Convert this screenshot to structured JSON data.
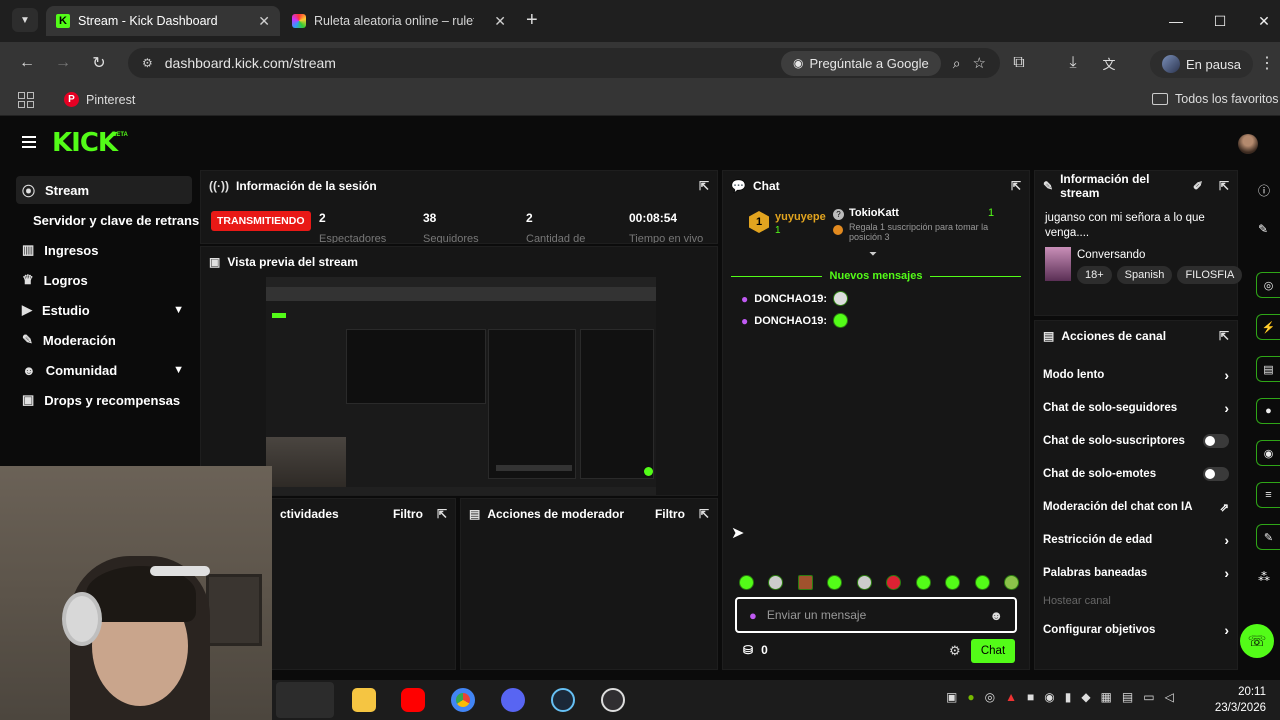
{
  "browser": {
    "tabs": [
      {
        "title": "Stream - Kick Dashboard",
        "active": true
      },
      {
        "title": "Ruleta aleatoria online – ruleta",
        "active": false
      }
    ],
    "url": "dashboard.kick.com/stream",
    "ask_google": "Pregúntale a Google",
    "profile_status": "En pausa",
    "bookmark": "Pinterest",
    "all_bookmarks": "Todos los favoritos"
  },
  "kick": {
    "logo": "KICK",
    "logo_badge": "BETA",
    "sidebar": [
      {
        "label": "Stream",
        "icon": "broadcast-icon",
        "selected": true
      },
      {
        "label": "Servidor y clave de retransm",
        "icon": "",
        "sub": true
      },
      {
        "label": "Ingresos",
        "icon": "chart-icon"
      },
      {
        "label": "Logros",
        "icon": "trophy-icon"
      },
      {
        "label": "Estudio",
        "icon": "video-icon",
        "expandable": true
      },
      {
        "label": "Moderación",
        "icon": "wrench-icon"
      },
      {
        "label": "Comunidad",
        "icon": "people-icon",
        "expandable": true
      },
      {
        "label": "Drops y recompensas",
        "icon": "gift-icon"
      }
    ],
    "session": {
      "title": "Información de la sesión",
      "status": "TRANSMITIENDO",
      "stats": [
        {
          "value": "2",
          "label": "Espectadores"
        },
        {
          "value": "38",
          "label": "Seguidores"
        },
        {
          "value": "2",
          "label": "Cantidad de"
        },
        {
          "value": "00:08:54",
          "label": "Tiempo en vivo"
        }
      ]
    },
    "preview": {
      "title": "Vista previa del stream"
    },
    "activity": {
      "title": "ctividades",
      "filter": "Filtro"
    },
    "mod_actions": {
      "title": "Acciones de moderador",
      "filter": "Filtro"
    },
    "chat": {
      "title": "Chat",
      "pinned_user": "yuyuyepe",
      "pinned_rank": "1",
      "pinned_count": "1",
      "gifter": "TokioKatt",
      "gifter_count": "1",
      "gift_text": "Regala 1 suscripción para tomar la posición 3",
      "new_messages": "Nuevos mensajes",
      "messages": [
        {
          "user": "DONCHAO19:"
        },
        {
          "user": "DONCHAO19:"
        }
      ],
      "placeholder": "Enviar un mensaje",
      "points": "0",
      "send": "Chat"
    },
    "stream_info": {
      "title": "Información del stream",
      "stream_title": "juganso con mi señora a lo que venga....",
      "category": "Conversando",
      "tags": [
        "18+",
        "Spanish",
        "FILOSFIA"
      ]
    },
    "channel_actions": {
      "title": "Acciones de canal",
      "items": [
        {
          "label": "Modo lento",
          "control": "arrow"
        },
        {
          "label": "Chat de solo-seguidores",
          "control": "arrow"
        },
        {
          "label": "Chat de solo-suscriptores",
          "control": "toggle"
        },
        {
          "label": "Chat de solo-emotes",
          "control": "toggle"
        },
        {
          "label": "Moderación del chat con IA",
          "control": "external"
        },
        {
          "label": "Restricción de edad",
          "control": "arrow"
        },
        {
          "label": "Palabras baneadas",
          "control": "arrow"
        },
        {
          "label": "Hostear canal",
          "control": "none",
          "disabled": true
        },
        {
          "label": "Configurar objetivos",
          "control": "arrow"
        }
      ]
    }
  },
  "taskbar": {
    "time": "20:11",
    "date": "23/3/2026"
  },
  "colors": {
    "accent": "#53fc18",
    "live": "#e91916",
    "panel": "#161616",
    "bg": "#0b0b0b"
  }
}
